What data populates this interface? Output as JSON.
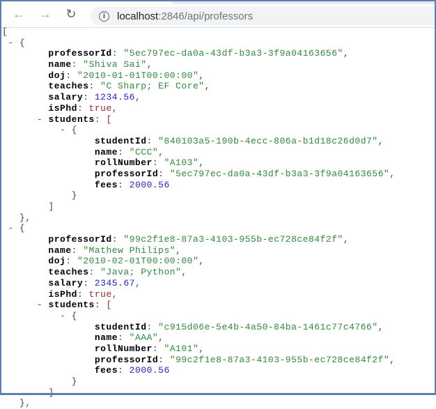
{
  "browser": {
    "url_host": "localhost",
    "url_rest": ":2846/api/professors",
    "back_icon": "←",
    "forward_icon": "→",
    "reload_icon": "↻",
    "info_icon": "i"
  },
  "professors": [
    {
      "professorId": "5ec797ec-da0a-43df-b3a3-3f9a04163656",
      "name": "Shiva Sai",
      "doj": "2010-01-01T00:00:00",
      "teaches": "C Sharp; EF Core",
      "salary": "1234.56",
      "isPhd": "true",
      "students": [
        {
          "studentId": "840103a5-190b-4ecc-806a-b1d18c26d0d7",
          "name": "CCC",
          "rollNumber": "A103",
          "professorId": "5ec797ec-da0a-43df-b3a3-3f9a04163656",
          "fees": "2000.56"
        }
      ]
    },
    {
      "professorId": "99c2f1e8-87a3-4103-955b-ec728ce84f2f",
      "name": "Mathew Philips",
      "doj": "2010-02-01T00:00:00",
      "teaches": "Java; Python",
      "salary": "2345.67",
      "isPhd": "true",
      "students": [
        {
          "studentId": "c915d06e-5e4b-4a50-84ba-1461c77c4766",
          "name": "AAA",
          "rollNumber": "A101",
          "professorId": "99c2f1e8-87a3-4103-955b-ec728ce84f2f",
          "fees": "2000.56"
        }
      ]
    }
  ]
}
